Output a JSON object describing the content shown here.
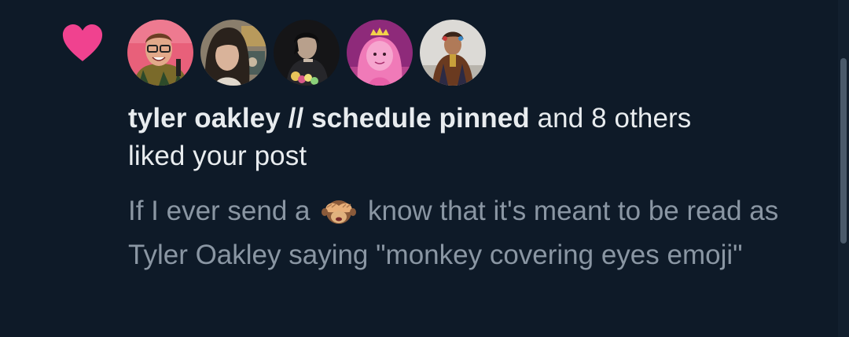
{
  "notification": {
    "icon": "heart-icon",
    "accent_color": "#f0428f",
    "avatars": [
      {
        "name": "avatar-1",
        "bg": "#e8607a"
      },
      {
        "name": "avatar-2",
        "bg": "#6e5a48"
      },
      {
        "name": "avatar-3",
        "bg": "#1c1c1f"
      },
      {
        "name": "avatar-4",
        "bg": "#a8348f"
      },
      {
        "name": "avatar-5",
        "bg": "#d8d6d2"
      }
    ],
    "actor_name": "tyler oakley // schedule pinned",
    "action_text_1": " and 8 others",
    "action_text_2": "liked your post",
    "snippet_before": "If I ever send a ",
    "snippet_emoji": "see-no-evil-monkey-emoji",
    "snippet_after": " know that it's meant to be read as Tyler Oakley saying \"monkey covering eyes emoji\""
  }
}
